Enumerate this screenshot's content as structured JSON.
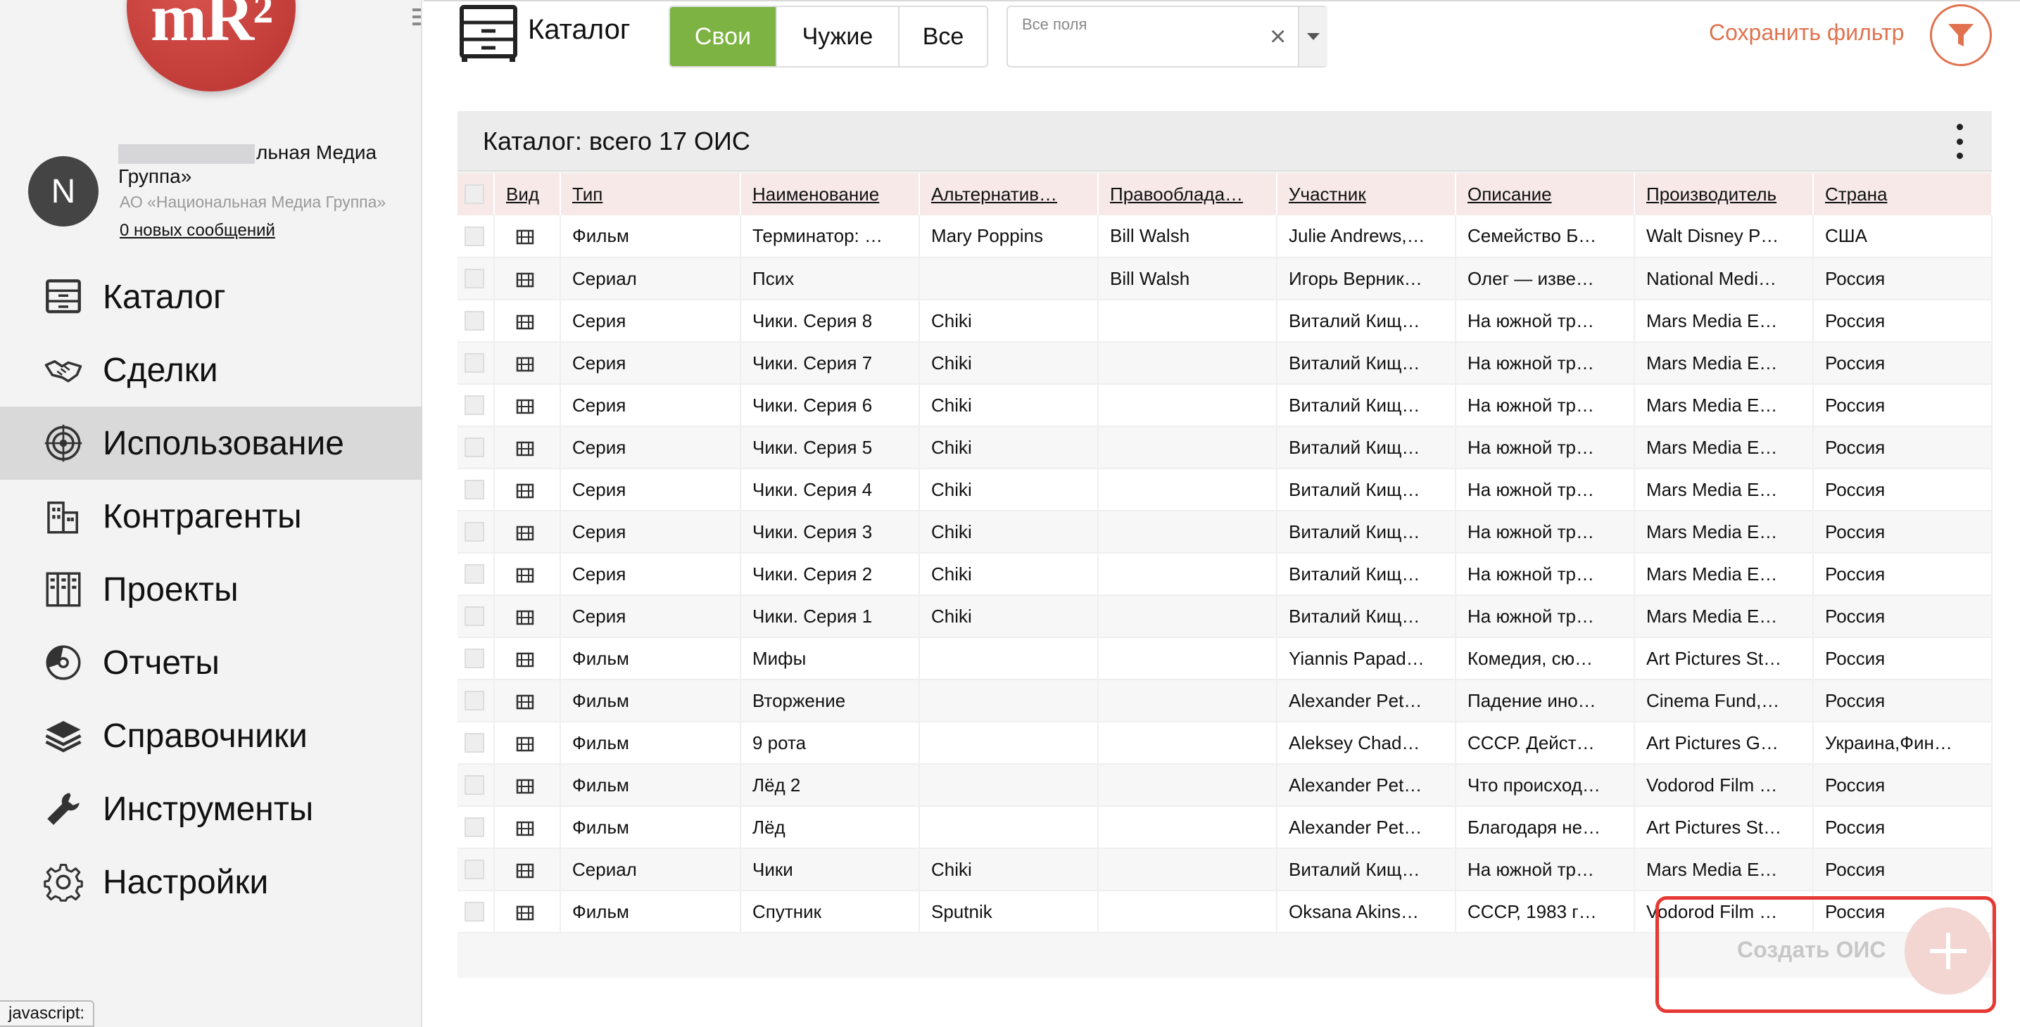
{
  "sidebar": {
    "logo_text": "mR²",
    "user": {
      "avatar_letter": "N",
      "name_line1": "льная Медиа",
      "name_line2": "Группа»",
      "org": "АО «Национальная Медиа Группа»",
      "messages": "0 новых сообщений"
    },
    "nav": [
      {
        "label": "Каталог",
        "icon": "cabinet-icon"
      },
      {
        "label": "Сделки",
        "icon": "handshake-icon"
      },
      {
        "label": "Использование",
        "icon": "target-icon"
      },
      {
        "label": "Контрагенты",
        "icon": "buildings-icon"
      },
      {
        "label": "Проекты",
        "icon": "projects-icon"
      },
      {
        "label": "Отчеты",
        "icon": "reports-icon"
      },
      {
        "label": "Справочники",
        "icon": "layers-icon"
      },
      {
        "label": "Инструменты",
        "icon": "wrench-icon"
      },
      {
        "label": "Настройки",
        "icon": "gear-icon"
      }
    ],
    "active_index": 2
  },
  "status_bar": {
    "text": "javascript:"
  },
  "header": {
    "title": "Каталог",
    "segments": [
      "Свои",
      "Чужие",
      "Все"
    ],
    "active_segment": 0,
    "search": {
      "label": "Все поля",
      "value": ""
    },
    "save_filter": "Сохранить фильтр"
  },
  "panel": {
    "title": "Каталог: всего 17 ОИС",
    "columns": [
      "Вид",
      "Тип",
      "Наименование",
      "Альтернатив…",
      "Правооблада…",
      "Участник",
      "Описание",
      "Производитель",
      "Страна"
    ],
    "rows": [
      [
        "Фильм",
        "Терминатор: …",
        "Mary Poppins",
        "Bill Walsh",
        "Julie Andrews,…",
        "Семейство Б…",
        "Walt Disney P…",
        "США"
      ],
      [
        "Сериал",
        "Псих",
        "",
        "Bill Walsh",
        "Игорь Верник…",
        "Олег — изве…",
        "National Medi…",
        "Россия"
      ],
      [
        "Серия",
        "Чики. Серия 8",
        "Chiki",
        "",
        "Виталий Кищ…",
        "На южной тр…",
        "Mars Media E…",
        "Россия"
      ],
      [
        "Серия",
        "Чики. Серия 7",
        "Chiki",
        "",
        "Виталий Кищ…",
        "На южной тр…",
        "Mars Media E…",
        "Россия"
      ],
      [
        "Серия",
        "Чики. Серия 6",
        "Chiki",
        "",
        "Виталий Кищ…",
        "На южной тр…",
        "Mars Media E…",
        "Россия"
      ],
      [
        "Серия",
        "Чики. Серия 5",
        "Chiki",
        "",
        "Виталий Кищ…",
        "На южной тр…",
        "Mars Media E…",
        "Россия"
      ],
      [
        "Серия",
        "Чики. Серия 4",
        "Chiki",
        "",
        "Виталий Кищ…",
        "На южной тр…",
        "Mars Media E…",
        "Россия"
      ],
      [
        "Серия",
        "Чики. Серия 3",
        "Chiki",
        "",
        "Виталий Кищ…",
        "На южной тр…",
        "Mars Media E…",
        "Россия"
      ],
      [
        "Серия",
        "Чики. Серия 2",
        "Chiki",
        "",
        "Виталий Кищ…",
        "На южной тр…",
        "Mars Media E…",
        "Россия"
      ],
      [
        "Серия",
        "Чики. Серия 1",
        "Chiki",
        "",
        "Виталий Кищ…",
        "На южной тр…",
        "Mars Media E…",
        "Россия"
      ],
      [
        "Фильм",
        "Мифы",
        "",
        "",
        "Yiannis Papad…",
        "Комедия, сю…",
        "Art Pictures St…",
        "Россия"
      ],
      [
        "Фильм",
        "Вторжение",
        "",
        "",
        "Alexander Pet…",
        "Падение ино…",
        "Cinema Fund,…",
        "Россия"
      ],
      [
        "Фильм",
        "9 рота",
        "",
        "",
        "Aleksey Chad…",
        "СССР. Дейст…",
        "Art Pictures G…",
        "Украина,Фин…"
      ],
      [
        "Фильм",
        "Лёд 2",
        "",
        "",
        "Alexander Pet…",
        "Что происход…",
        "Vodorod Film …",
        "Россия"
      ],
      [
        "Фильм",
        "Лёд",
        "",
        "",
        "Alexander Pet…",
        "Благодаря не…",
        "Art Pictures St…",
        "Россия"
      ],
      [
        "Сериал",
        "Чики",
        "Chiki",
        "",
        "Виталий Кищ…",
        "На южной тр…",
        "Mars Media E…",
        "Россия"
      ],
      [
        "Фильм",
        "Спутник",
        "Sputnik",
        "",
        "Oksana Akins…",
        "СССР, 1983 г…",
        "Vodorod Film …",
        "Россия"
      ]
    ],
    "create_label": "Создать ОИС"
  },
  "colors": {
    "accent_green": "#7cb342",
    "accent_orange": "#e0724f",
    "logo_red": "#c33e39",
    "highlight_red": "#e53935"
  }
}
